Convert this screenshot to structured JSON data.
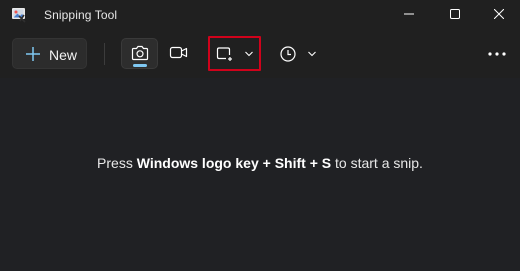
{
  "window": {
    "title": "Snipping Tool",
    "controls": [
      "minimize-icon",
      "maximize-icon",
      "close-icon"
    ]
  },
  "toolbar": {
    "new_label": "New",
    "modes": [
      {
        "name": "snip-photo",
        "icon": "camera-icon",
        "selected": true
      },
      {
        "name": "record-video",
        "icon": "video-camera-icon",
        "selected": false
      }
    ],
    "snip_mode_icon": "rectangle-snip-icon",
    "delay_icon": "clock-icon",
    "more_icon": "more-horizontal-icon",
    "accent_color": "#7fc8f2",
    "highlight_color": "#d0021b"
  },
  "main": {
    "hint_prefix": "Press ",
    "hint_key1": "Windows logo key",
    "hint_plus1": " + ",
    "hint_key2": "Shift",
    "hint_plus2": " + ",
    "hint_key3": "S",
    "hint_suffix": " to start a snip."
  }
}
